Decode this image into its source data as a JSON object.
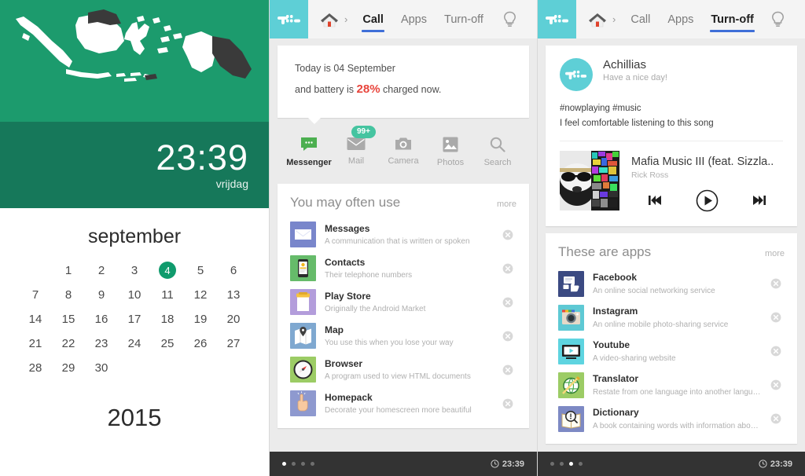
{
  "left_panel": {
    "map_region": "indonesia-map",
    "clock": {
      "time": "23:39",
      "day": "vrijdag"
    },
    "calendar": {
      "month": "september",
      "year": "2015",
      "leading_blanks": 1,
      "days": [
        "1",
        "2",
        "3",
        "4",
        "5",
        "6",
        "7",
        "8",
        "9",
        "10",
        "11",
        "12",
        "13",
        "14",
        "15",
        "16",
        "17",
        "18",
        "19",
        "20",
        "21",
        "22",
        "23",
        "24",
        "25",
        "26",
        "27",
        "28",
        "29",
        "30"
      ],
      "today": "4"
    }
  },
  "colors": {
    "green_top": "#1c9b6d",
    "green_bottom": "#16785a",
    "accent_teal": "#5ecfd6",
    "tab_underline": "#3f6fd8",
    "battery_red": "#e8453c",
    "badge_green": "#45c4a0"
  },
  "phone_center": {
    "topbar": {
      "logo": "tl-logo-icon",
      "home": "home-icon",
      "chevron": "›",
      "tabs": [
        {
          "label": "Call",
          "active": true
        },
        {
          "label": "Apps",
          "active": false
        },
        {
          "label": "Turn-off",
          "active": false
        }
      ],
      "bulb": "lightbulb-icon"
    },
    "notice": {
      "line1": "Today is 04 September",
      "line2_pre": "and battery is ",
      "percent": "28%",
      "line2_post": " charged now."
    },
    "quick_actions": [
      {
        "label": "Messenger",
        "icon": "messenger-icon",
        "active": true,
        "badge": ""
      },
      {
        "label": "Mail",
        "icon": "mail-icon",
        "active": false,
        "badge": "99+"
      },
      {
        "label": "Camera",
        "icon": "camera-icon",
        "active": false,
        "badge": ""
      },
      {
        "label": "Photos",
        "icon": "photos-icon",
        "active": false,
        "badge": ""
      },
      {
        "label": "Search",
        "icon": "search-icon",
        "active": false,
        "badge": ""
      }
    ],
    "list": {
      "title": "You may often use",
      "more": "more",
      "items": [
        {
          "name": "Messages",
          "desc": "A communication that is written or spoken",
          "icon": "messages-app-icon"
        },
        {
          "name": "Contacts",
          "desc": "Their telephone numbers",
          "icon": "contacts-app-icon"
        },
        {
          "name": "Play Store",
          "desc": "Originally the Android Market",
          "icon": "playstore-app-icon"
        },
        {
          "name": "Map",
          "desc": "You use this when you lose your way",
          "icon": "map-app-icon"
        },
        {
          "name": "Browser",
          "desc": "A program used to view HTML documents",
          "icon": "browser-app-icon"
        },
        {
          "name": "Homepack",
          "desc": "Decorate your homescreen more beautiful",
          "icon": "homepack-app-icon"
        }
      ]
    },
    "statusbar": {
      "dots": 4,
      "active_dot": 0,
      "time": "23:39"
    }
  },
  "phone_right": {
    "topbar": {
      "logo": "tl-logo-icon",
      "home": "home-icon",
      "chevron": "›",
      "tabs": [
        {
          "label": "Call",
          "active": false
        },
        {
          "label": "Apps",
          "active": false
        },
        {
          "label": "Turn-off",
          "active": true
        }
      ],
      "bulb": "lightbulb-icon"
    },
    "social": {
      "user": "Achillias",
      "status": "Have a nice day!",
      "post_line1": "#nowplaying #music",
      "post_line2": "I feel comfortable listening to this song",
      "track_title": "Mafia Music III (feat. Sizzla..",
      "track_artist": "Rick Ross",
      "controls": [
        "prev-track-icon",
        "play-icon",
        "next-track-icon"
      ]
    },
    "list": {
      "title": "These are apps",
      "more": "more",
      "items": [
        {
          "name": "Facebook",
          "desc": "An online social networking service",
          "icon": "facebook-app-icon"
        },
        {
          "name": "Instagram",
          "desc": "An online mobile photo-sharing service",
          "icon": "instagram-app-icon"
        },
        {
          "name": "Youtube",
          "desc": "A video-sharing website",
          "icon": "youtube-app-icon"
        },
        {
          "name": "Translator",
          "desc": "Restate from one language into another language",
          "icon": "translator-app-icon"
        },
        {
          "name": "Dictionary",
          "desc": "A book containing words with information about them",
          "icon": "dictionary-app-icon"
        }
      ]
    },
    "statusbar": {
      "dots": 4,
      "active_dot": 2,
      "time": "23:39"
    }
  }
}
